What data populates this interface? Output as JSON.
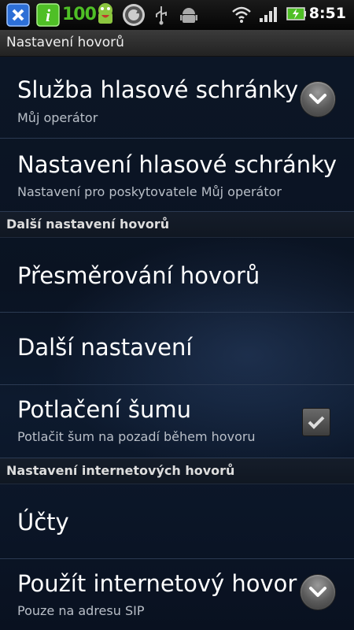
{
  "status_bar": {
    "battery_level_label": "100",
    "time": "8:51"
  },
  "header": {
    "title": "Nastavení hovorů"
  },
  "items": [
    {
      "title": "Služba hlasové schránky",
      "subtitle": "Můj operátor"
    },
    {
      "title": "Nastavení hlasové schránky",
      "subtitle": "Nastavení pro poskytovatele Můj operátor"
    }
  ],
  "section1": {
    "title": "Další nastavení hovorů"
  },
  "items2": [
    {
      "title": "Přesměrování hovorů"
    },
    {
      "title": "Další nastavení"
    },
    {
      "title": "Potlačení šumu",
      "subtitle": "Potlačit šum na pozadí během hovoru",
      "checked": true
    }
  ],
  "section2": {
    "title": "Nastavení internetových hovorů"
  },
  "items3": [
    {
      "title": "Účty"
    },
    {
      "title": "Použít internetový hovor",
      "subtitle": "Pouze na adresu SIP"
    }
  ],
  "icons": [
    "app-x-icon",
    "info-icon",
    "android-mascot-icon",
    "sync-icon",
    "usb-icon",
    "android-icon",
    "wifi-icon",
    "signal-icon",
    "battery-icon",
    "chevron-down-icon",
    "checkmark-icon"
  ],
  "colors": {
    "accent_green": "#4fbf26",
    "background": "#0b1424"
  }
}
